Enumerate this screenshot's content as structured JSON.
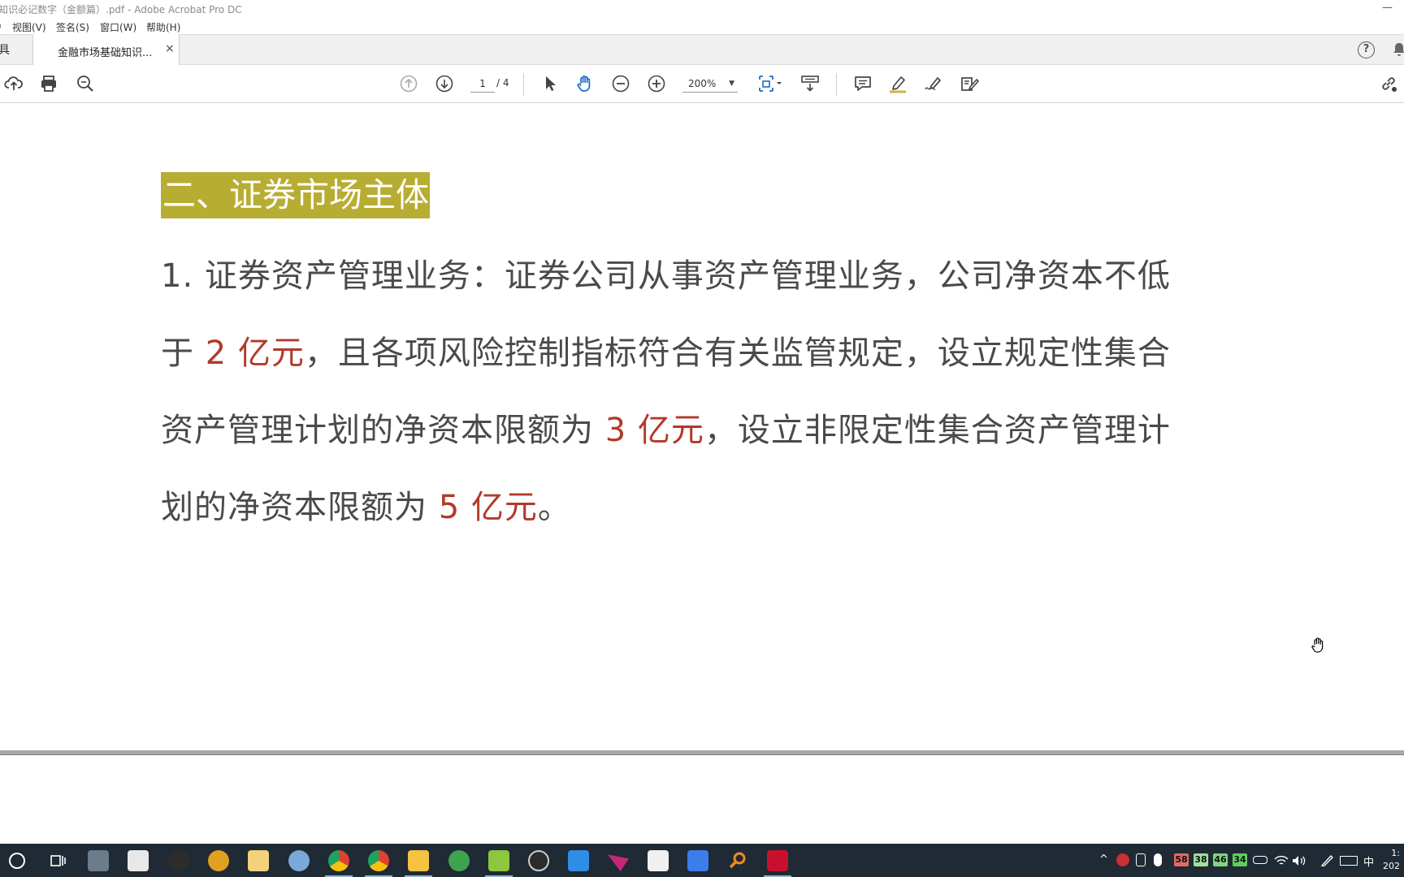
{
  "window": {
    "title": "知识必记数字（金额篇）.pdf - Adobe Acrobat Pro DC",
    "minimize_glyph": "—"
  },
  "menu": [
    "视图(V)",
    "签名(S)",
    "窗口(W)",
    "帮助(H)"
  ],
  "tabs": {
    "tools_label": "具",
    "document_label": "金融市场基础知识...",
    "close_glyph": "×",
    "help_glyph": "?"
  },
  "toolbar": {
    "current_page": "1",
    "total_pages": "/ 4",
    "zoom": "200%",
    "zoom_caret": "▼"
  },
  "document": {
    "heading": "二、证券市场主体",
    "lines": [
      [
        {
          "t": "1. 证券资产管理业务：证券公司从事资产管理业务，公司净资本不低",
          "red": false
        }
      ],
      [
        {
          "t": "于 ",
          "red": false
        },
        {
          "t": "2 亿元",
          "red": true
        },
        {
          "t": "，且各项风险控制指标符合有关监管规定，设立规定性集合",
          "red": false
        }
      ],
      [
        {
          "t": "资产管理计划的净资本限额为 ",
          "red": false
        },
        {
          "t": "3 亿元",
          "red": true
        },
        {
          "t": "，设立非限定性集合资产管理计",
          "red": false
        }
      ],
      [
        {
          "t": "划的净资本限额为 ",
          "red": false
        },
        {
          "t": "5 亿元",
          "red": true
        },
        {
          "t": "。",
          "red": false
        }
      ]
    ]
  },
  "colors": {
    "heading_bg": "#b8ad33",
    "highlight_red": "#b13a2a",
    "body_text": "#4a4a4a",
    "taskbar_bg": "#1f2a34"
  },
  "taskbar": {
    "apps": [
      "cortana",
      "task-view",
      "file-manager",
      "notepad",
      "obs",
      "media-player",
      "search-tool",
      "paint",
      "chrome",
      "chrome-2",
      "explorer",
      "maps",
      "notepad-plus",
      "obs-2",
      "wps",
      "flag-app",
      "baidu-netdisk",
      "feishu",
      "search-app",
      "acrobat"
    ],
    "tray": {
      "badges": [
        {
          "value": "58",
          "color": "#e26a6a"
        },
        {
          "value": "38",
          "color": "#9ee09e"
        },
        {
          "value": "46",
          "color": "#7fd67f"
        },
        {
          "value": "34",
          "color": "#5ccf5c"
        }
      ],
      "ime": "中",
      "chevron": "^",
      "clock_line1": "1:",
      "clock_line2": "202"
    }
  }
}
